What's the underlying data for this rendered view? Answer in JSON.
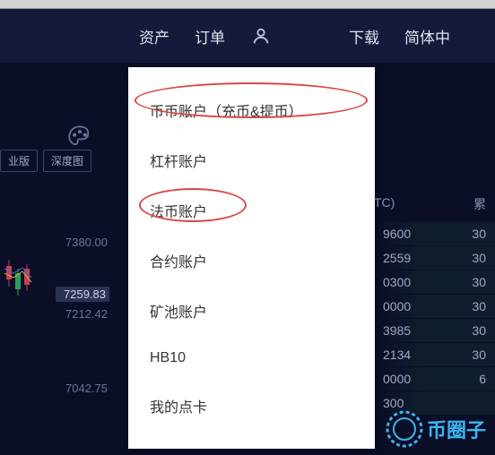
{
  "nav": {
    "assets": "资产",
    "orders": "订单",
    "download": "下载",
    "lang": "简体中"
  },
  "buttons": {
    "pro": "业版",
    "depth": "深度图"
  },
  "prices": {
    "p1": "7380.00",
    "p2": "7259.83",
    "p3": "7212.42",
    "p4": "7042.75"
  },
  "dropdown": {
    "items": [
      "币币账户（充币&提币）",
      "杠杆账户",
      "法币账户",
      "合约账户",
      "矿池账户",
      "HB10",
      "我的点卡"
    ]
  },
  "orderbook": {
    "header_qty": "TC)",
    "header_cum": "累",
    "rows": [
      {
        "qty": "9600",
        "cum": "30"
      },
      {
        "qty": "2559",
        "cum": "30"
      },
      {
        "qty": "0300",
        "cum": "30"
      },
      {
        "qty": "0000",
        "cum": "30"
      },
      {
        "qty": "3985",
        "cum": "30"
      },
      {
        "qty": "2134",
        "cum": "30"
      },
      {
        "qty": "0000",
        "cum": "6"
      },
      {
        "qty": "300",
        "cum": ""
      }
    ]
  },
  "watermark": {
    "text": "币圈子"
  }
}
